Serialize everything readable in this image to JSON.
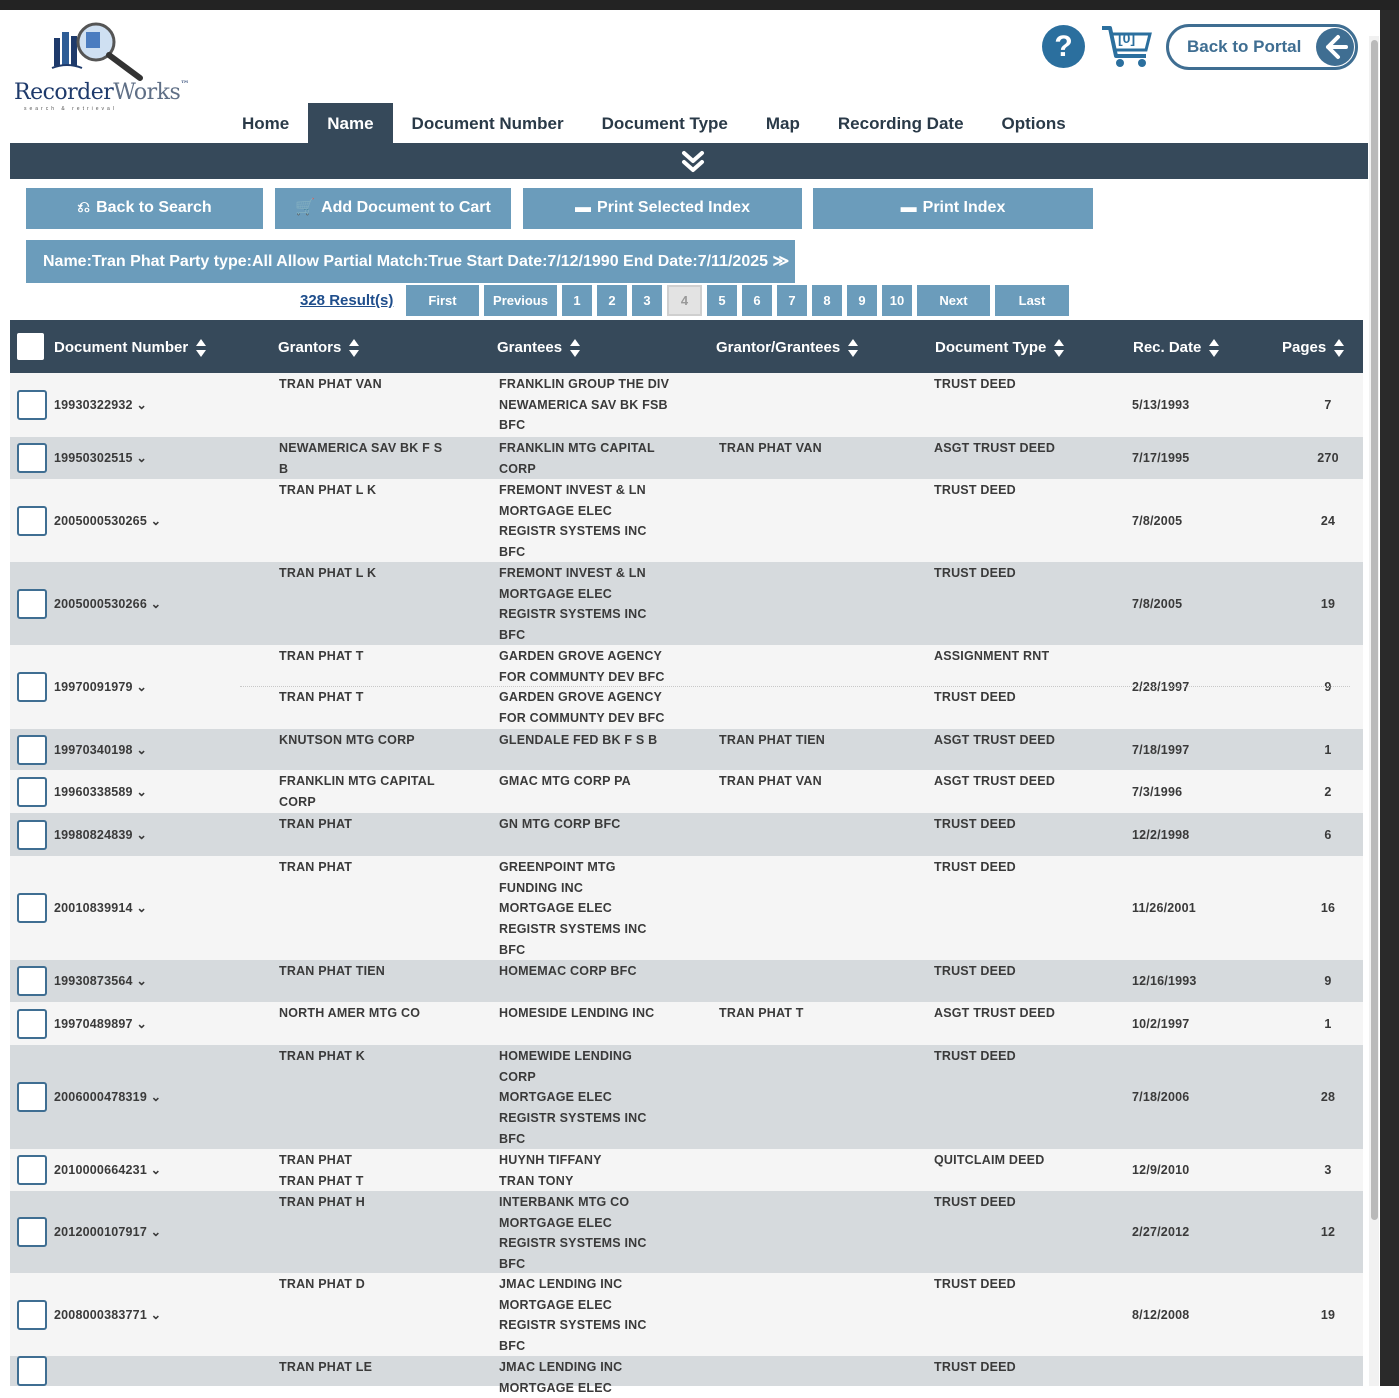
{
  "app": {
    "logo": {
      "name": "Recorder",
      "name2": "Works",
      "tm": "™",
      "tagline": "search & retrieval"
    },
    "cart_count": "[0]",
    "help_glyph": "?",
    "back_to_portal": "Back to Portal"
  },
  "nav": {
    "tabs": [
      "Home",
      "Name",
      "Document Number",
      "Document Type",
      "Map",
      "Recording Date",
      "Options"
    ],
    "active": "Name"
  },
  "actions": {
    "back_to_search": "Back to Search",
    "add_to_cart": "Add Document to Cart",
    "print_selected": "Print Selected Index",
    "print_index": "Print Index"
  },
  "criteria": "Name:Tran Phat Party type:All Allow Partial Match:True Start Date:7/12/1990 End Date:7/11/2025 ≫",
  "pager": {
    "results": "328 Result(s)",
    "first": "First",
    "previous": "Previous",
    "pages": [
      "1",
      "2",
      "3",
      "4",
      "5",
      "6",
      "7",
      "8",
      "9",
      "10"
    ],
    "current": "4",
    "next": "Next",
    "last": "Last"
  },
  "table": {
    "headers": [
      "Document Number",
      "Grantors",
      "Grantees",
      "Grantor/Grantees",
      "Document Type",
      "Rec. Date",
      "Pages"
    ],
    "rows": [
      {
        "doc": "19930322932",
        "grantors": [
          "TRAN PHAT VAN"
        ],
        "grantees": [
          "FRANKLIN GROUP THE DIV",
          "NEWAMERICA SAV BK FSB",
          "BFC"
        ],
        "gg": [],
        "type": [
          "TRUST DEED"
        ],
        "date": "5/13/1993",
        "pages": "7"
      },
      {
        "doc": "19950302515",
        "grantors": [
          "NEWAMERICA SAV BK F S",
          "B"
        ],
        "grantees": [
          "FRANKLIN MTG CAPITAL",
          "CORP"
        ],
        "gg": [
          "TRAN PHAT VAN"
        ],
        "type": [
          "ASGT TRUST DEED"
        ],
        "date": "7/17/1995",
        "pages": "270"
      },
      {
        "doc": "2005000530265",
        "grantors": [
          "TRAN PHAT L K"
        ],
        "grantees": [
          "FREMONT INVEST & LN",
          "MORTGAGE ELEC",
          "REGISTR SYSTEMS INC",
          "BFC"
        ],
        "gg": [],
        "type": [
          "TRUST DEED"
        ],
        "date": "7/8/2005",
        "pages": "24"
      },
      {
        "doc": "2005000530266",
        "grantors": [
          "TRAN PHAT L K"
        ],
        "grantees": [
          "FREMONT INVEST & LN",
          "MORTGAGE ELEC",
          "REGISTR SYSTEMS INC",
          "BFC"
        ],
        "gg": [],
        "type": [
          "TRUST DEED"
        ],
        "date": "7/8/2005",
        "pages": "19"
      },
      {
        "doc": "19970091979",
        "grantors": [
          "TRAN PHAT T",
          "",
          "TRAN PHAT T"
        ],
        "grantees": [
          "GARDEN GROVE AGENCY",
          "FOR COMMUNTY DEV BFC",
          "GARDEN GROVE AGENCY",
          "FOR COMMUNTY DEV BFC"
        ],
        "gg": [],
        "type": [
          "ASSIGNMENT RNT",
          "",
          "TRUST DEED"
        ],
        "date": "2/28/1997",
        "pages": "9"
      },
      {
        "doc": "19970340198",
        "grantors": [
          "KNUTSON MTG CORP"
        ],
        "grantees": [
          "GLENDALE FED BK F S B"
        ],
        "gg": [
          "TRAN PHAT TIEN"
        ],
        "type": [
          "ASGT TRUST DEED"
        ],
        "date": "7/18/1997",
        "pages": "1"
      },
      {
        "doc": "19960338589",
        "grantors": [
          "FRANKLIN MTG CAPITAL",
          "CORP"
        ],
        "grantees": [
          "GMAC MTG CORP PA"
        ],
        "gg": [
          "TRAN PHAT VAN"
        ],
        "type": [
          "ASGT TRUST DEED"
        ],
        "date": "7/3/1996",
        "pages": "2"
      },
      {
        "doc": "19980824839",
        "grantors": [
          "TRAN PHAT"
        ],
        "grantees": [
          "GN MTG CORP BFC"
        ],
        "gg": [],
        "type": [
          "TRUST DEED"
        ],
        "date": "12/2/1998",
        "pages": "6"
      },
      {
        "doc": "20010839914",
        "grantors": [
          "TRAN PHAT"
        ],
        "grantees": [
          "GREENPOINT MTG",
          "FUNDING INC",
          "MORTGAGE ELEC",
          "REGISTR SYSTEMS INC",
          "BFC"
        ],
        "gg": [],
        "type": [
          "TRUST DEED"
        ],
        "date": "11/26/2001",
        "pages": "16"
      },
      {
        "doc": "19930873564",
        "grantors": [
          "TRAN PHAT TIEN"
        ],
        "grantees": [
          "HOMEMAC CORP BFC"
        ],
        "gg": [],
        "type": [
          "TRUST DEED"
        ],
        "date": "12/16/1993",
        "pages": "9"
      },
      {
        "doc": "19970489897",
        "grantors": [
          "NORTH AMER MTG CO"
        ],
        "grantees": [
          "HOMESIDE LENDING INC"
        ],
        "gg": [
          "TRAN PHAT T"
        ],
        "type": [
          "ASGT TRUST DEED"
        ],
        "date": "10/2/1997",
        "pages": "1"
      },
      {
        "doc": "2006000478319",
        "grantors": [
          "TRAN PHAT K"
        ],
        "grantees": [
          "HOMEWIDE LENDING",
          "CORP",
          "MORTGAGE ELEC",
          "REGISTR SYSTEMS INC",
          "BFC"
        ],
        "gg": [],
        "type": [
          "TRUST DEED"
        ],
        "date": "7/18/2006",
        "pages": "28"
      },
      {
        "doc": "2010000664231",
        "grantors": [
          "TRAN PHAT",
          "TRAN PHAT T"
        ],
        "grantees": [
          "HUYNH TIFFANY",
          "TRAN TONY"
        ],
        "gg": [],
        "type": [
          "QUITCLAIM DEED"
        ],
        "date": "12/9/2010",
        "pages": "3"
      },
      {
        "doc": "2012000107917",
        "grantors": [
          "TRAN PHAT H"
        ],
        "grantees": [
          "INTERBANK MTG CO",
          "MORTGAGE ELEC",
          "REGISTR SYSTEMS INC",
          "BFC"
        ],
        "gg": [],
        "type": [
          "TRUST DEED"
        ],
        "date": "2/27/2012",
        "pages": "12"
      },
      {
        "doc": "2008000383771",
        "grantors": [
          "TRAN PHAT D"
        ],
        "grantees": [
          "JMAC LENDING INC",
          "MORTGAGE ELEC",
          "REGISTR SYSTEMS INC",
          "BFC"
        ],
        "gg": [],
        "type": [
          "TRUST DEED"
        ],
        "date": "8/12/2008",
        "pages": "19"
      },
      {
        "doc": "",
        "grantors": [
          "TRAN PHAT LE"
        ],
        "grantees": [
          "JMAC LENDING INC",
          "MORTGAGE ELEC"
        ],
        "gg": [],
        "type": [
          "TRUST DEED"
        ],
        "date": "",
        "pages": ""
      }
    ]
  },
  "colors": {
    "header": "#36495a",
    "button": "#6b9cbb",
    "row_alt": "#d6dadd",
    "accent": "#3f6e92"
  }
}
